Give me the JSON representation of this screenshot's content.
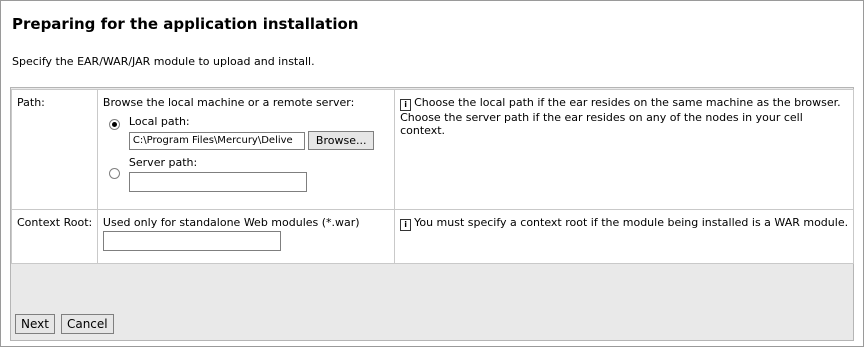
{
  "header": {
    "title": "Preparing for the application installation",
    "subtitle": "Specify the EAR/WAR/JAR module to upload and install."
  },
  "path_row": {
    "label": "Path:",
    "browse_text": "Browse the local machine or a remote server:",
    "local_label": "Local path:",
    "local_value": "C:\\Program Files\\Mercury\\Delive",
    "browse_button": "Browse...",
    "server_label": "Server path:",
    "server_value": "",
    "selected_option": "Local path",
    "info_icon": "info-icon",
    "help": "Choose the local path if the ear resides on the same machine as the browser. Choose the server path if the ear resides on any of the nodes in your cell context."
  },
  "context_row": {
    "label": "Context Root:",
    "description": "Used only for standalone Web modules (*.war)",
    "value": "",
    "info_icon": "info-icon",
    "help": "You must specify a context root if the module being installed is a WAR module."
  },
  "footer": {
    "next": "Next",
    "cancel": "Cancel"
  }
}
